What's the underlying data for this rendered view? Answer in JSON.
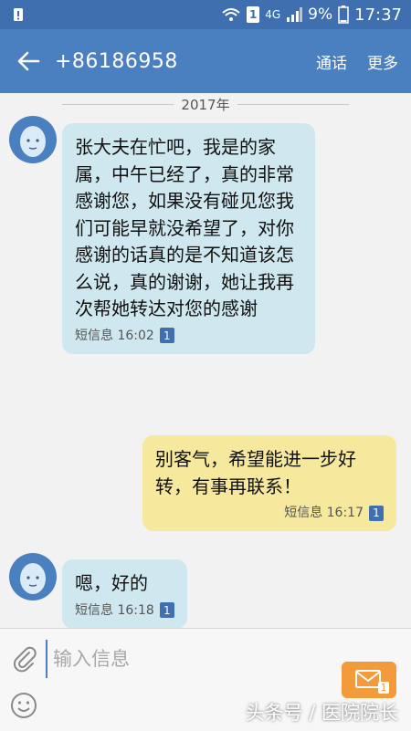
{
  "status_bar": {
    "network": "4G",
    "battery": "9%",
    "time": "17:37",
    "sim": "1"
  },
  "header": {
    "contact": "+86186958",
    "call_label": "通话",
    "more_label": "更多"
  },
  "date_divider": "2017年",
  "messages": [
    {
      "direction": "in",
      "text": "张大夫在忙吧，我是的家属，中午已经了，真的非常感谢您，如果没有碰见您我们可能早就没希望了，对你感谢的话真的是不知道该怎么说，真的谢谢，她让我再次帮她转达对您的感谢",
      "meta": "短信息 16:02",
      "sim": "1"
    },
    {
      "direction": "out",
      "text": "别客气，希望能进一步好转，有事再联系！",
      "meta": "短信息 16:17",
      "sim": "1"
    },
    {
      "direction": "in",
      "text": "嗯，好的",
      "meta": "短信息 16:18",
      "sim": "1"
    }
  ],
  "composer": {
    "placeholder": "输入信息",
    "send_badge": "1"
  },
  "watermark": "头条号 / 医院院长",
  "colors": {
    "header": "#4a7fc0",
    "status": "#3f6fae",
    "incoming": "#cfe7ef",
    "outgoing": "#f6e89c",
    "send": "#f39a3a"
  }
}
